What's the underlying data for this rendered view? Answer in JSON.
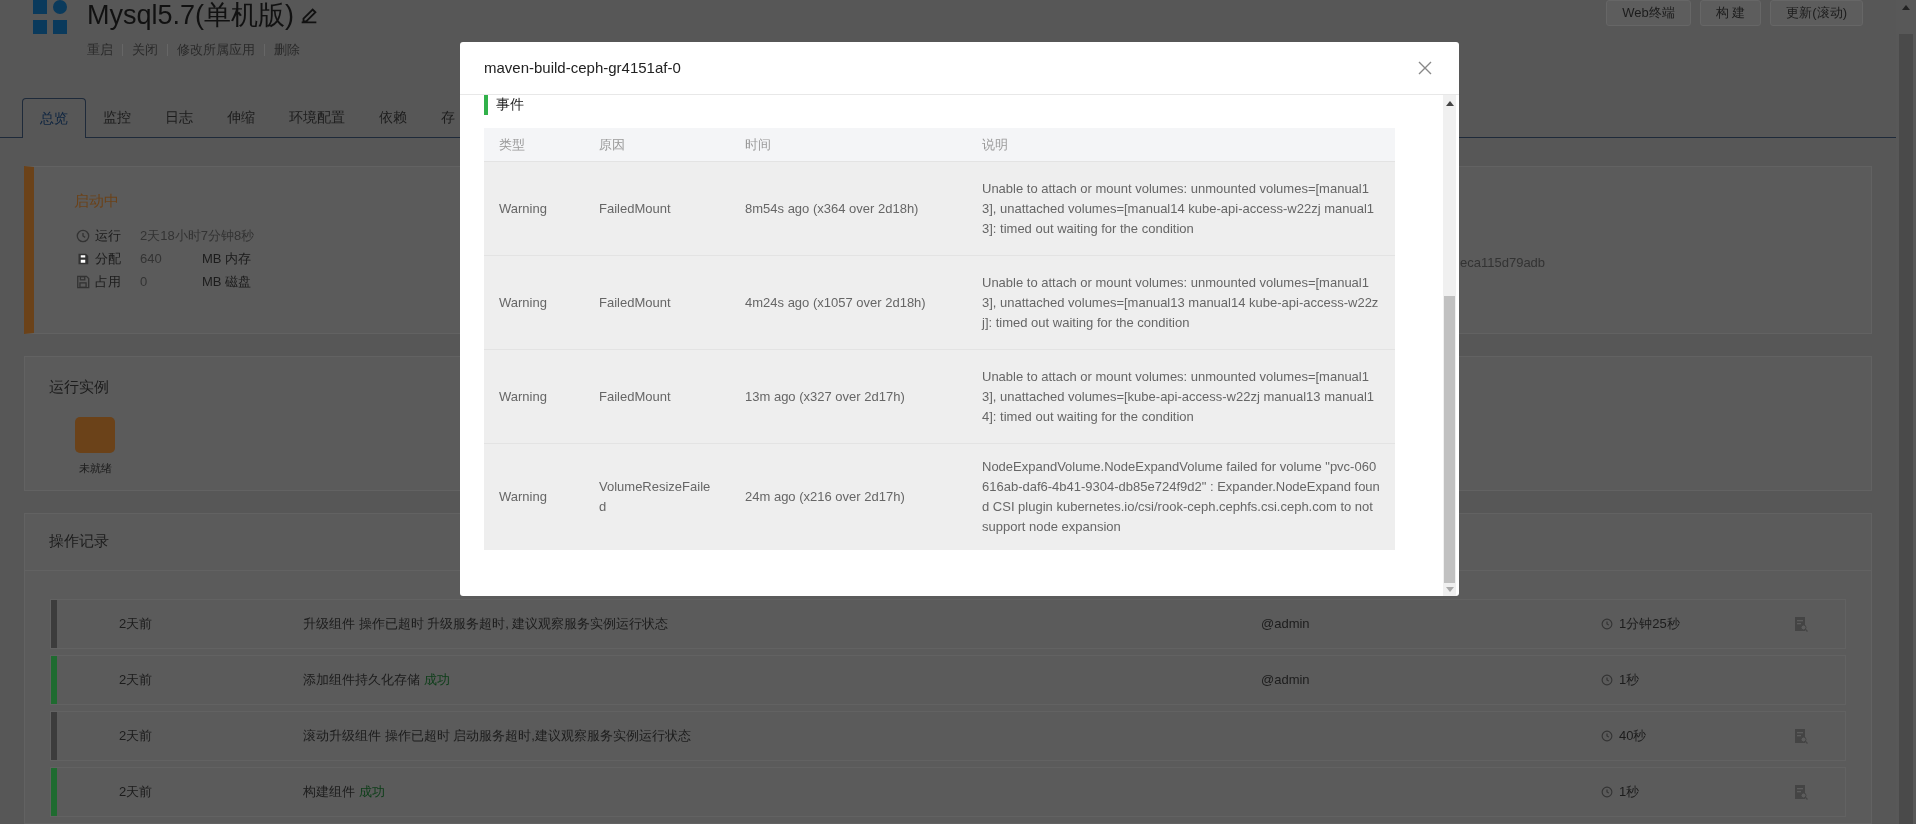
{
  "app": {
    "title": "Mysql5.7(单机版)",
    "actions": [
      "重启",
      "关闭",
      "修改所属应用",
      "删除"
    ],
    "buttons": [
      "Web终端",
      "构 建",
      "更新(滚动)"
    ]
  },
  "tabs": [
    {
      "label": "总览",
      "selected": true
    },
    {
      "label": "监控",
      "selected": false
    },
    {
      "label": "日志",
      "selected": false
    },
    {
      "label": "伸缩",
      "selected": false
    },
    {
      "label": "环境配置",
      "selected": false
    },
    {
      "label": "依赖",
      "selected": false
    },
    {
      "label": "存",
      "selected": false
    }
  ],
  "status": {
    "label": "启动中",
    "color": "#6b4219",
    "rows": [
      {
        "kind": "clock",
        "label": "运行",
        "value": "2天18小时7分钟8秒"
      },
      {
        "kind": "memory",
        "label": "分配",
        "value": "640",
        "unit": "MB 内存"
      },
      {
        "kind": "disk",
        "label": "占用",
        "value": "0",
        "unit": "MB 磁盘"
      }
    ],
    "hash": "eca115d79adb"
  },
  "instances": {
    "title": "运行实例",
    "items": [
      {
        "label": "未就绪",
        "color": "#6b4219"
      }
    ]
  },
  "operations": {
    "title": "操作记录",
    "rows": [
      {
        "color": "#3c3c3c",
        "time": "2天前",
        "text": "升级组件 操作已超时 升级服务超时, 建议观察服务实例运行状态",
        "user": "@admin",
        "duration": "1分钟25秒",
        "has_log": true
      },
      {
        "color": "#1f6b30",
        "time": "2天前",
        "text": "添加组件持久化存储",
        "result": "成功",
        "user": "@admin",
        "duration": "1秒",
        "has_log": false
      },
      {
        "color": "#3c3c3c",
        "time": "2天前",
        "text": "滚动升级组件 操作已超时 启动服务超时,建议观察服务实例运行状态",
        "duration": "40秒",
        "has_log": true
      },
      {
        "color": "#1f6b30",
        "time": "2天前",
        "text": "构建组件",
        "result": "成功",
        "duration": "1秒",
        "has_log": true
      }
    ]
  },
  "modal": {
    "title": "maven-build-ceph-gr4151af-0",
    "section": "事件",
    "columns": [
      "类型",
      "原因",
      "时间",
      "说明"
    ],
    "rows": [
      [
        "Warning",
        "FailedMount",
        "8m54s ago (x364 over 2d18h)",
        "Unable to attach or mount volumes: unmounted volumes=[manual13], unattached volumes=[manual14 kube-api-access-w22zj manual13]: timed out waiting for the condition"
      ],
      [
        "Warning",
        "FailedMount",
        "4m24s ago (x1057 over 2d18h)",
        "Unable to attach or mount volumes: unmounted volumes=[manual13], unattached volumes=[manual13 manual14 kube-api-access-w22zj]: timed out waiting for the condition"
      ],
      [
        "Warning",
        "FailedMount",
        "13m ago (x327 over 2d17h)",
        "Unable to attach or mount volumes: unmounted volumes=[manual13], unattached volumes=[kube-api-access-w22zj manual13 manual14]: timed out waiting for the condition"
      ],
      [
        "Warning",
        "VolumeResizeFailed",
        "24m ago (x216 over 2d17h)",
        "NodeExpandVolume.NodeExpandVolume failed for volume \"pvc-060616ab-daf6-4b41-9304-db85e724f9d2\" : Expander.NodeExpand found CSI plugin kubernetes.io/csi/rook-ceph.cephfs.csi.ceph.com to not support node expansion"
      ]
    ]
  }
}
